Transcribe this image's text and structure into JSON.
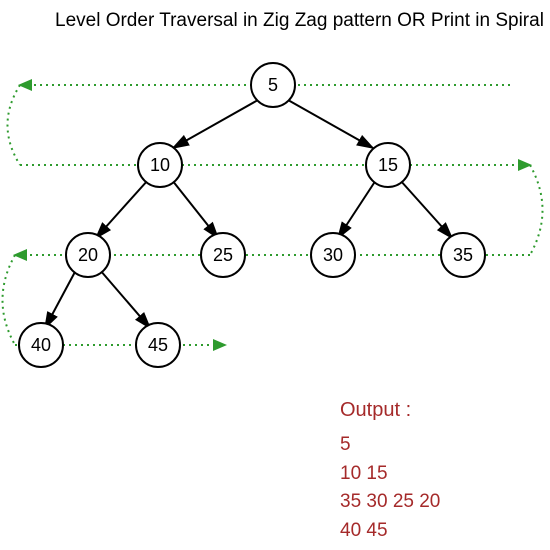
{
  "title": "Level Order Traversal in Zig Zag pattern OR Print in Spiral",
  "chart_data": {
    "type": "diagram",
    "tree": {
      "value": 5,
      "children": [
        {
          "value": 10,
          "children": [
            {
              "value": 20,
              "children": [
                {
                  "value": 40,
                  "children": []
                },
                {
                  "value": 45,
                  "children": []
                }
              ]
            },
            {
              "value": 25,
              "children": []
            }
          ]
        },
        {
          "value": 15,
          "children": [
            {
              "value": 30,
              "children": []
            },
            {
              "value": 35,
              "children": []
            }
          ]
        }
      ]
    },
    "traversal_pattern": "zigzag",
    "levels": [
      {
        "direction": "right-to-left",
        "values": [
          5
        ]
      },
      {
        "direction": "left-to-right",
        "values": [
          10,
          15
        ]
      },
      {
        "direction": "right-to-left",
        "values": [
          35,
          30,
          25,
          20
        ]
      },
      {
        "direction": "left-to-right",
        "values": [
          40,
          45
        ]
      }
    ],
    "path_color": "#2e9b2e"
  },
  "nodes": {
    "n5": "5",
    "n10": "10",
    "n15": "15",
    "n20": "20",
    "n25": "25",
    "n30": "30",
    "n35": "35",
    "n40": "40",
    "n45": "45"
  },
  "output": {
    "title": "Output :",
    "lines": [
      "5",
      "10 15",
      "35 30 25 20",
      "40 45"
    ]
  }
}
